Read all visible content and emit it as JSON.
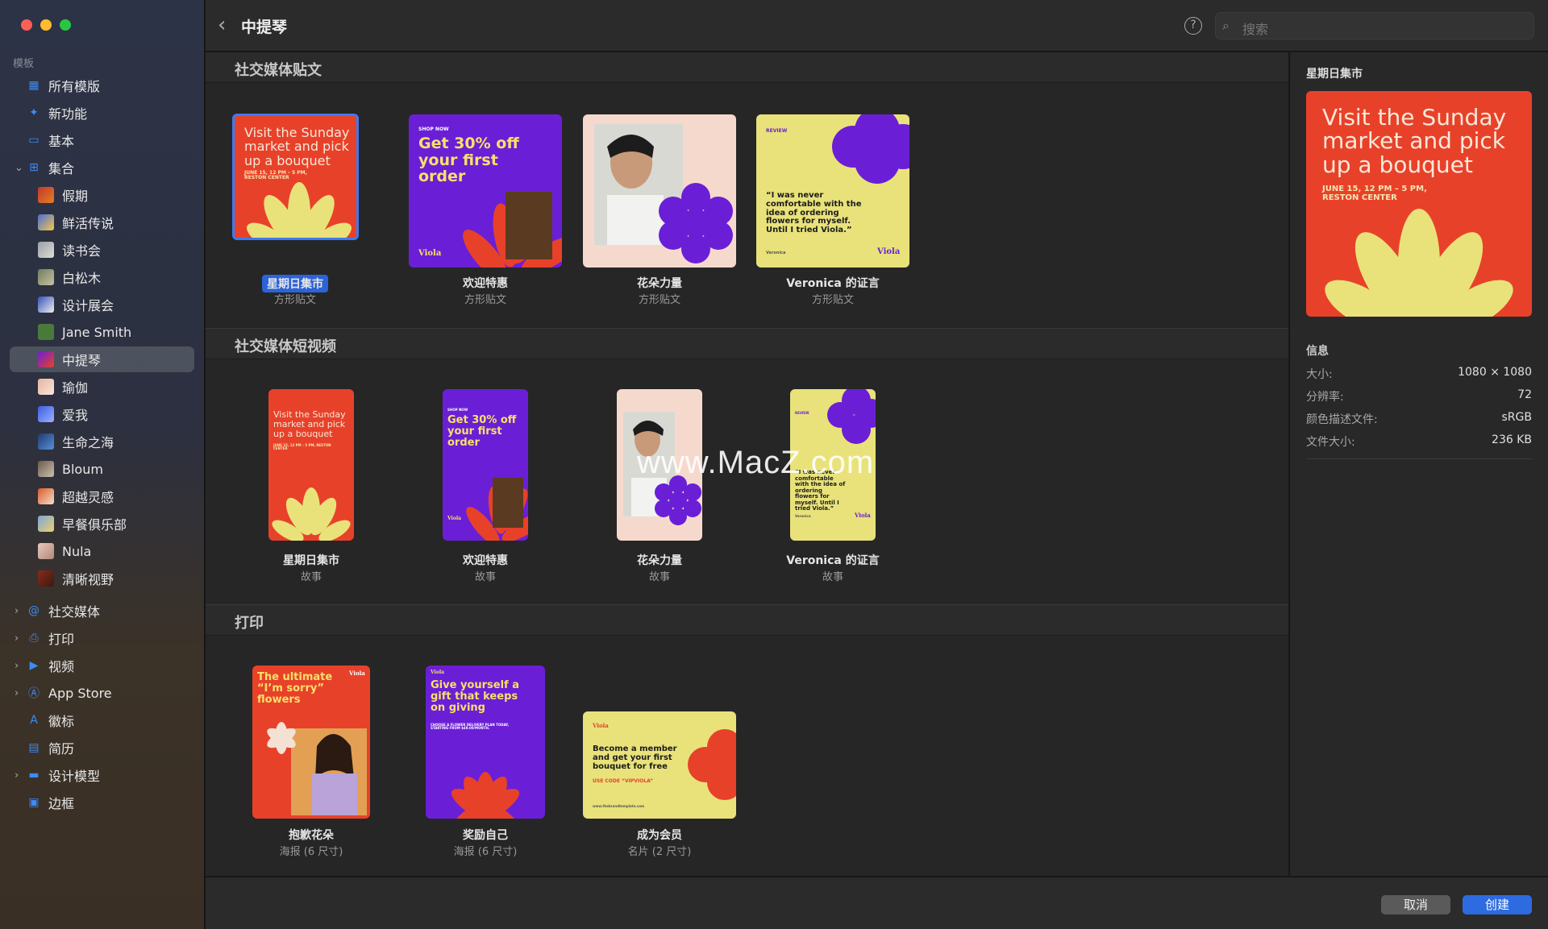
{
  "sidebar": {
    "section_label": "模板",
    "items": [
      {
        "label": "所有模版",
        "icon": "grid-icon"
      },
      {
        "label": "新功能",
        "icon": "sparkle-icon"
      },
      {
        "label": "基本",
        "icon": "template-icon"
      },
      {
        "label": "集合",
        "icon": "collection-icon"
      },
      {
        "label": "假期"
      },
      {
        "label": "鲜活传说"
      },
      {
        "label": "读书会"
      },
      {
        "label": "白松木"
      },
      {
        "label": "设计展会"
      },
      {
        "label": "Jane Smith"
      },
      {
        "label": "中提琴"
      },
      {
        "label": "瑜伽"
      },
      {
        "label": "爱我"
      },
      {
        "label": "生命之海"
      },
      {
        "label": "Bloum"
      },
      {
        "label": "超越灵感"
      },
      {
        "label": "早餐俱乐部"
      },
      {
        "label": "Nula"
      },
      {
        "label": "清晰视野"
      },
      {
        "label": "社交媒体",
        "icon": "at-icon"
      },
      {
        "label": "打印",
        "icon": "printer-icon"
      },
      {
        "label": "视频",
        "icon": "video-icon"
      },
      {
        "label": "App Store",
        "icon": "appstore-icon"
      },
      {
        "label": "徽标",
        "icon": "logo-icon"
      },
      {
        "label": "简历",
        "icon": "resume-icon"
      },
      {
        "label": "设计模型",
        "icon": "mockup-icon"
      },
      {
        "label": "边框",
        "icon": "frame-icon"
      }
    ]
  },
  "topbar": {
    "title": "中提琴",
    "search_placeholder": "搜索",
    "help": "?"
  },
  "sections": [
    {
      "title": "社交媒体贴文",
      "items": [
        {
          "name": "星期日集市",
          "kind": "方形贴文"
        },
        {
          "name": "欢迎特惠",
          "kind": "方形贴文"
        },
        {
          "name": "花朵力量",
          "kind": "方形贴文"
        },
        {
          "name": "Veronica 的证言",
          "kind": "方形贴文"
        }
      ]
    },
    {
      "title": "社交媒体短视频",
      "items": [
        {
          "name": "星期日集市",
          "kind": "故事"
        },
        {
          "name": "欢迎特惠",
          "kind": "故事"
        },
        {
          "name": "花朵力量",
          "kind": "故事"
        },
        {
          "name": "Veronica 的证言",
          "kind": "故事"
        }
      ]
    },
    {
      "title": "打印",
      "items": [
        {
          "name": "抱歉花朵",
          "kind": "海报 (6 尺寸)"
        },
        {
          "name": "奖励自己",
          "kind": "海报 (6 尺寸)"
        },
        {
          "name": "成为会员",
          "kind": "名片 (2 尺寸)"
        }
      ]
    }
  ],
  "thumb_text": {
    "sunday": "Visit the Sunday market and pick up a bouquet",
    "sunday_date": "JUNE 15, 12 PM – 5 PM, RESTON CENTER",
    "shop_now": "SHOP NOW",
    "offer": "Get 30% off your first order",
    "viola": "Viola",
    "review": "REVIEW",
    "quote": "“I was never comfortable with the idea of ordering flowers for myself. Until I tried Viola.”",
    "veronica": "Veronica",
    "sorry": "The ultimate “I’m sorry” flowers",
    "gift": "Give yourself a gift that keeps on giving",
    "gift_sub": "CHOOSE A FLOWER DELIVERY PLAN TODAY, STARTING FROM $49.00/MONTH.",
    "member": "Become a member and get your first bouquet for free",
    "code": "USE CODE “VIPVIOLA”",
    "site": "www.thebrandtemplate.com"
  },
  "details": {
    "title": "星期日集市",
    "info_heading": "信息",
    "rows": [
      {
        "k": "大小:",
        "v": "1080 × 1080"
      },
      {
        "k": "分辨率:",
        "v": "72"
      },
      {
        "k": "颜色描述文件:",
        "v": "sRGB"
      },
      {
        "k": "文件大小:",
        "v": "236 KB"
      }
    ]
  },
  "buttons": {
    "cancel": "取消",
    "create": "创建"
  },
  "watermark": "www.MacZ.com",
  "colors": {
    "red": "#e8412a",
    "purple": "#6a1fd6",
    "yellow": "#e9e27a",
    "pink": "#f6d9cd",
    "accent": "#2d63d8"
  }
}
